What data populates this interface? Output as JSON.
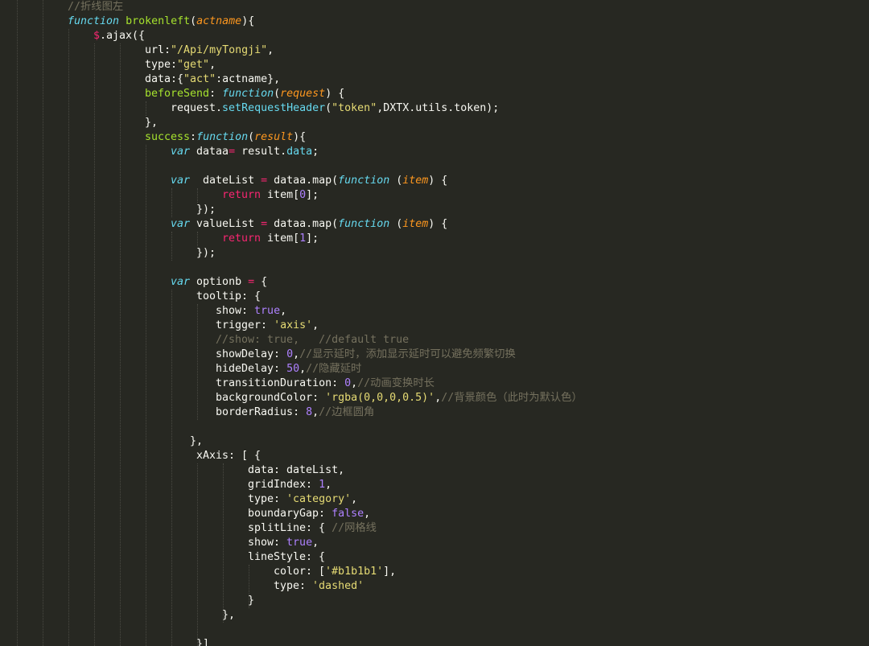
{
  "editor": {
    "theme_colors": {
      "background": "#272822",
      "text": "#f8f8f2",
      "keyword": "#66d9ef",
      "function_name": "#a6e22e",
      "argument": "#fd971f",
      "string": "#e6db74",
      "comment": "#75715e",
      "number": "#ae81ff",
      "operator": "#f92672"
    },
    "lines": [
      {
        "indent": 84,
        "tokens": [
          {
            "t": "//折线图左",
            "c": "c"
          }
        ]
      },
      {
        "indent": 84,
        "tokens": [
          {
            "t": "function",
            "c": "k"
          },
          {
            "t": " ",
            "c": "p"
          },
          {
            "t": "brokenleft",
            "c": "n"
          },
          {
            "t": "(",
            "c": "p"
          },
          {
            "t": "actname",
            "c": "a"
          },
          {
            "t": "){",
            "c": "p"
          }
        ]
      },
      {
        "indent": 116,
        "tokens": [
          {
            "t": "$",
            "c": "d"
          },
          {
            "t": ".ajax({",
            "c": "p"
          }
        ]
      },
      {
        "indent": 180,
        "tokens": [
          {
            "t": "url:",
            "c": "p"
          },
          {
            "t": "\"/Api/myTongji\"",
            "c": "s"
          },
          {
            "t": ",",
            "c": "p"
          }
        ]
      },
      {
        "indent": 180,
        "tokens": [
          {
            "t": "type:",
            "c": "p"
          },
          {
            "t": "\"get\"",
            "c": "s"
          },
          {
            "t": ",",
            "c": "p"
          }
        ]
      },
      {
        "indent": 180,
        "tokens": [
          {
            "t": "data:{",
            "c": "p"
          },
          {
            "t": "\"act\"",
            "c": "s"
          },
          {
            "t": ":actname},",
            "c": "p"
          }
        ]
      },
      {
        "indent": 180,
        "tokens": [
          {
            "t": "beforeSend",
            "c": "h"
          },
          {
            "t": ": ",
            "c": "p"
          },
          {
            "t": "function",
            "c": "k"
          },
          {
            "t": "(",
            "c": "p"
          },
          {
            "t": "request",
            "c": "a"
          },
          {
            "t": ") {",
            "c": "p"
          }
        ]
      },
      {
        "indent": 212,
        "tokens": [
          {
            "t": "request.",
            "c": "p"
          },
          {
            "t": "setRequestHeader",
            "c": "k2"
          },
          {
            "t": "(",
            "c": "p"
          },
          {
            "t": "\"token\"",
            "c": "s"
          },
          {
            "t": ",DXTX.utils.token);",
            "c": "p"
          }
        ]
      },
      {
        "indent": 180,
        "tokens": [
          {
            "t": "},",
            "c": "p"
          }
        ]
      },
      {
        "indent": 180,
        "tokens": [
          {
            "t": "success",
            "c": "h"
          },
          {
            "t": ":",
            "c": "p"
          },
          {
            "t": "function",
            "c": "k"
          },
          {
            "t": "(",
            "c": "p"
          },
          {
            "t": "result",
            "c": "a"
          },
          {
            "t": "){",
            "c": "p"
          }
        ]
      },
      {
        "indent": 212,
        "tokens": [
          {
            "t": "var",
            "c": "k"
          },
          {
            "t": " dataa",
            "c": "p"
          },
          {
            "t": "=",
            "c": "g"
          },
          {
            "t": " result.",
            "c": "p"
          },
          {
            "t": "data",
            "c": "k2"
          },
          {
            "t": ";",
            "c": "p"
          }
        ]
      },
      {
        "indent": 212,
        "tokens": []
      },
      {
        "indent": 212,
        "tokens": [
          {
            "t": "var",
            "c": "k"
          },
          {
            "t": "  dateList ",
            "c": "p"
          },
          {
            "t": "=",
            "c": "g"
          },
          {
            "t": " dataa.map(",
            "c": "p"
          },
          {
            "t": "function",
            "c": "k"
          },
          {
            "t": " (",
            "c": "p"
          },
          {
            "t": "item",
            "c": "a"
          },
          {
            "t": ") {",
            "c": "p"
          }
        ]
      },
      {
        "indent": 276,
        "tokens": [
          {
            "t": "return",
            "c": "r"
          },
          {
            "t": " item[",
            "c": "p"
          },
          {
            "t": "0",
            "c": "v"
          },
          {
            "t": "];",
            "c": "p"
          }
        ]
      },
      {
        "indent": 244,
        "tokens": [
          {
            "t": "});",
            "c": "p"
          }
        ]
      },
      {
        "indent": 212,
        "tokens": [
          {
            "t": "var",
            "c": "k"
          },
          {
            "t": " valueList ",
            "c": "p"
          },
          {
            "t": "=",
            "c": "g"
          },
          {
            "t": " dataa.map(",
            "c": "p"
          },
          {
            "t": "function",
            "c": "k"
          },
          {
            "t": " (",
            "c": "p"
          },
          {
            "t": "item",
            "c": "a"
          },
          {
            "t": ") {",
            "c": "p"
          }
        ]
      },
      {
        "indent": 276,
        "tokens": [
          {
            "t": "return",
            "c": "r"
          },
          {
            "t": " item[",
            "c": "p"
          },
          {
            "t": "1",
            "c": "v"
          },
          {
            "t": "];",
            "c": "p"
          }
        ]
      },
      {
        "indent": 244,
        "tokens": [
          {
            "t": "});",
            "c": "p"
          }
        ]
      },
      {
        "indent": 212,
        "tokens": []
      },
      {
        "indent": 212,
        "tokens": [
          {
            "t": "var",
            "c": "k"
          },
          {
            "t": " optionb ",
            "c": "p"
          },
          {
            "t": "=",
            "c": "g"
          },
          {
            "t": " {",
            "c": "p"
          }
        ]
      },
      {
        "indent": 244,
        "tokens": [
          {
            "t": "tooltip: {",
            "c": "p"
          }
        ]
      },
      {
        "indent": 268,
        "tokens": [
          {
            "t": "show: ",
            "c": "p"
          },
          {
            "t": "true",
            "c": "v"
          },
          {
            "t": ",",
            "c": "p"
          }
        ]
      },
      {
        "indent": 268,
        "tokens": [
          {
            "t": "trigger: ",
            "c": "p"
          },
          {
            "t": "'axis'",
            "c": "s"
          },
          {
            "t": ",",
            "c": "p"
          }
        ]
      },
      {
        "indent": 268,
        "tokens": [
          {
            "t": "//show: true,   //default true",
            "c": "c"
          }
        ]
      },
      {
        "indent": 268,
        "tokens": [
          {
            "t": "showDelay: ",
            "c": "p"
          },
          {
            "t": "0",
            "c": "v"
          },
          {
            "t": ",",
            "c": "p"
          },
          {
            "t": "//显示延时，添加显示延时可以避免频繁切换",
            "c": "c"
          }
        ]
      },
      {
        "indent": 268,
        "tokens": [
          {
            "t": "hideDelay: ",
            "c": "p"
          },
          {
            "t": "50",
            "c": "v"
          },
          {
            "t": ",",
            "c": "p"
          },
          {
            "t": "//隐藏延时",
            "c": "c"
          }
        ]
      },
      {
        "indent": 268,
        "tokens": [
          {
            "t": "transitionDuration: ",
            "c": "p"
          },
          {
            "t": "0",
            "c": "v"
          },
          {
            "t": ",",
            "c": "p"
          },
          {
            "t": "//动画变换时长",
            "c": "c"
          }
        ]
      },
      {
        "indent": 268,
        "tokens": [
          {
            "t": "backgroundColor: ",
            "c": "p"
          },
          {
            "t": "'rgba(0,0,0,0.5)'",
            "c": "s"
          },
          {
            "t": ",",
            "c": "p"
          },
          {
            "t": "//背景颜色（此时为默认色）",
            "c": "c"
          }
        ]
      },
      {
        "indent": 268,
        "tokens": [
          {
            "t": "borderRadius: ",
            "c": "p"
          },
          {
            "t": "8",
            "c": "v"
          },
          {
            "t": ",",
            "c": "p"
          },
          {
            "t": "//边框圆角",
            "c": "c"
          }
        ]
      },
      {
        "indent": 268,
        "tokens": []
      },
      {
        "indent": 236,
        "tokens": [
          {
            "t": "},",
            "c": "p"
          }
        ]
      },
      {
        "indent": 244,
        "tokens": [
          {
            "t": "xAxis: [ {",
            "c": "p"
          }
        ]
      },
      {
        "indent": 308,
        "tokens": [
          {
            "t": "data: dateList,",
            "c": "p"
          }
        ]
      },
      {
        "indent": 308,
        "tokens": [
          {
            "t": "gridIndex: ",
            "c": "p"
          },
          {
            "t": "1",
            "c": "v"
          },
          {
            "t": ",",
            "c": "p"
          }
        ]
      },
      {
        "indent": 308,
        "tokens": [
          {
            "t": "type: ",
            "c": "p"
          },
          {
            "t": "'category'",
            "c": "s"
          },
          {
            "t": ",",
            "c": "p"
          }
        ]
      },
      {
        "indent": 308,
        "tokens": [
          {
            "t": "boundaryGap: ",
            "c": "p"
          },
          {
            "t": "false",
            "c": "v"
          },
          {
            "t": ",",
            "c": "p"
          }
        ]
      },
      {
        "indent": 308,
        "tokens": [
          {
            "t": "splitLine: { ",
            "c": "p"
          },
          {
            "t": "//网格线",
            "c": "c"
          }
        ]
      },
      {
        "indent": 308,
        "tokens": [
          {
            "t": "show: ",
            "c": "p"
          },
          {
            "t": "true",
            "c": "v"
          },
          {
            "t": ",",
            "c": "p"
          }
        ]
      },
      {
        "indent": 308,
        "tokens": [
          {
            "t": "lineStyle: {",
            "c": "p"
          }
        ]
      },
      {
        "indent": 340,
        "tokens": [
          {
            "t": "color: [",
            "c": "p"
          },
          {
            "t": "'#b1b1b1'",
            "c": "s"
          },
          {
            "t": "],",
            "c": "p"
          }
        ]
      },
      {
        "indent": 340,
        "tokens": [
          {
            "t": "type: ",
            "c": "p"
          },
          {
            "t": "'dashed'",
            "c": "s"
          }
        ]
      },
      {
        "indent": 308,
        "tokens": [
          {
            "t": "}",
            "c": "p"
          }
        ]
      },
      {
        "indent": 276,
        "tokens": [
          {
            "t": "},",
            "c": "p"
          }
        ]
      },
      {
        "indent": 276,
        "tokens": []
      },
      {
        "indent": 244,
        "tokens": [
          {
            "t": "}]",
            "c": "p"
          }
        ]
      }
    ]
  }
}
